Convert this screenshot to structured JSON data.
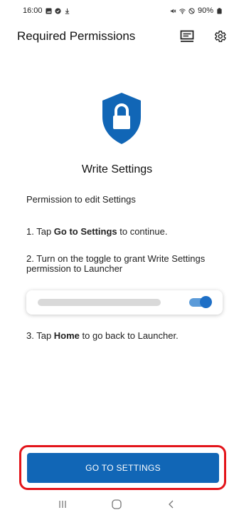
{
  "status_bar": {
    "time": "16:00",
    "battery": "90%",
    "left_icons": [
      "gallery-icon",
      "check-circle-icon",
      "download-icon"
    ],
    "right_icons": [
      "mute-icon",
      "wifi-icon",
      "do-not-disturb-icon",
      "battery-icon"
    ]
  },
  "header": {
    "title": "Required Permissions",
    "actions": [
      "tray-icon",
      "gear-icon"
    ]
  },
  "permission": {
    "icon": "lock-shield-icon",
    "title": "Write Settings",
    "description": "Permission to edit Settings",
    "step1": {
      "prefix": "1. Tap ",
      "bold": "Go to Settings",
      "suffix": " to continue."
    },
    "step2": " 2. Turn on the toggle to grant Write Settings permission to Launcher",
    "step3": {
      "prefix": "3. Tap ",
      "bold": "Home",
      "suffix": " to go back to Launcher."
    }
  },
  "illustration": {
    "toggle_state": "on"
  },
  "cta": {
    "label": "GO TO SETTINGS"
  },
  "nav": {
    "icons": [
      "recents-icon",
      "home-icon",
      "back-icon"
    ]
  },
  "colors": {
    "primary": "#1166b6",
    "highlight": "#e3141a",
    "toggle_track": "#5b9bd9",
    "toggle_knob": "#1e6fc6"
  }
}
